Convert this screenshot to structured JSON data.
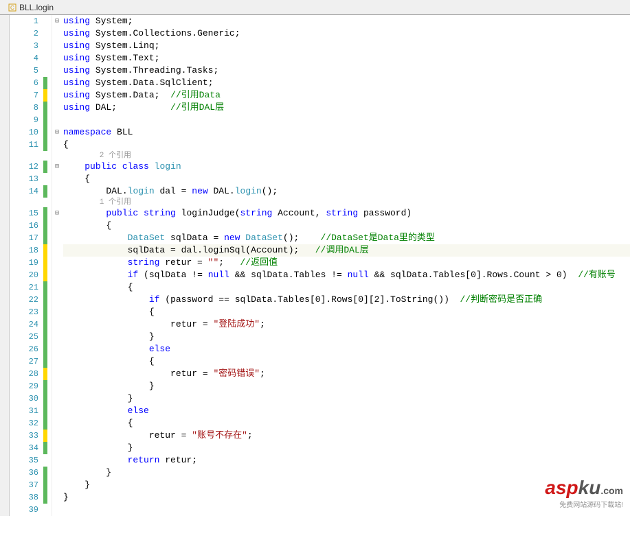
{
  "tab": {
    "title": "BLL.login"
  },
  "refs": {
    "ref2": "2 个引用",
    "ref1": "1 个引用"
  },
  "code": {
    "l1": {
      "p": [
        [
          "kw",
          "using"
        ],
        [
          "id",
          " System"
        ],
        [
          "pun",
          ";"
        ]
      ]
    },
    "l2": {
      "p": [
        [
          "kw",
          "using"
        ],
        [
          "id",
          " System"
        ],
        [
          "pun",
          "."
        ],
        [
          "id",
          "Collections"
        ],
        [
          "pun",
          "."
        ],
        [
          "id",
          "Generic"
        ],
        [
          "pun",
          ";"
        ]
      ]
    },
    "l3": {
      "p": [
        [
          "kw",
          "using"
        ],
        [
          "id",
          " System"
        ],
        [
          "pun",
          "."
        ],
        [
          "id",
          "Linq"
        ],
        [
          "pun",
          ";"
        ]
      ]
    },
    "l4": {
      "p": [
        [
          "kw",
          "using"
        ],
        [
          "id",
          " System"
        ],
        [
          "pun",
          "."
        ],
        [
          "id",
          "Text"
        ],
        [
          "pun",
          ";"
        ]
      ]
    },
    "l5": {
      "p": [
        [
          "kw",
          "using"
        ],
        [
          "id",
          " System"
        ],
        [
          "pun",
          "."
        ],
        [
          "id",
          "Threading"
        ],
        [
          "pun",
          "."
        ],
        [
          "id",
          "Tasks"
        ],
        [
          "pun",
          ";"
        ]
      ]
    },
    "l6": {
      "p": [
        [
          "kw",
          "using"
        ],
        [
          "id",
          " System"
        ],
        [
          "pun",
          "."
        ],
        [
          "id",
          "Data"
        ],
        [
          "pun",
          "."
        ],
        [
          "id",
          "SqlClient"
        ],
        [
          "pun",
          ";"
        ]
      ]
    },
    "l7": {
      "p": [
        [
          "kw",
          "using"
        ],
        [
          "id",
          " System"
        ],
        [
          "pun",
          "."
        ],
        [
          "id",
          "Data"
        ],
        [
          "pun",
          ";  "
        ],
        [
          "cm",
          "//引用Data"
        ]
      ]
    },
    "l8": {
      "p": [
        [
          "kw",
          "using"
        ],
        [
          "id",
          " DAL"
        ],
        [
          "pun",
          ";          "
        ],
        [
          "cm",
          "//引用DAL层"
        ]
      ]
    },
    "l9": {
      "p": []
    },
    "l10": {
      "p": [
        [
          "kw",
          "namespace"
        ],
        [
          "id",
          " BLL"
        ]
      ]
    },
    "l11": {
      "p": [
        [
          "pun",
          "{"
        ]
      ]
    },
    "l12": {
      "p": [
        [
          "id",
          "    "
        ],
        [
          "kw",
          "public"
        ],
        [
          "id",
          " "
        ],
        [
          "kw",
          "class"
        ],
        [
          "id",
          " "
        ],
        [
          "type",
          "login"
        ]
      ]
    },
    "l13": {
      "p": [
        [
          "pun",
          "    {"
        ]
      ]
    },
    "l14": {
      "p": [
        [
          "id",
          "        DAL"
        ],
        [
          "pun",
          "."
        ],
        [
          "type",
          "login"
        ],
        [
          "id",
          " dal "
        ],
        [
          "pun",
          "="
        ],
        [
          "id",
          " "
        ],
        [
          "kw",
          "new"
        ],
        [
          "id",
          " DAL"
        ],
        [
          "pun",
          "."
        ],
        [
          "type",
          "login"
        ],
        [
          "pun",
          "();"
        ]
      ]
    },
    "l15": {
      "p": [
        [
          "id",
          "        "
        ],
        [
          "kw",
          "public"
        ],
        [
          "id",
          " "
        ],
        [
          "kw",
          "string"
        ],
        [
          "id",
          " loginJudge"
        ],
        [
          "pun",
          "("
        ],
        [
          "kw",
          "string"
        ],
        [
          "id",
          " Account"
        ],
        [
          "pun",
          ", "
        ],
        [
          "kw",
          "string"
        ],
        [
          "id",
          " password"
        ],
        [
          "pun",
          ")"
        ]
      ]
    },
    "l16": {
      "p": [
        [
          "pun",
          "        {"
        ]
      ]
    },
    "l17": {
      "p": [
        [
          "id",
          "            "
        ],
        [
          "type",
          "DataSet"
        ],
        [
          "id",
          " sqlData "
        ],
        [
          "pun",
          "="
        ],
        [
          "id",
          " "
        ],
        [
          "kw",
          "new"
        ],
        [
          "id",
          " "
        ],
        [
          "type",
          "DataSet"
        ],
        [
          "pun",
          "();    "
        ],
        [
          "cm",
          "//DataSet是Data里的类型"
        ]
      ]
    },
    "l18": {
      "p": [
        [
          "id",
          "            sqlData "
        ],
        [
          "pun",
          "="
        ],
        [
          "id",
          " dal"
        ],
        [
          "pun",
          "."
        ],
        [
          "id",
          "loginSql"
        ],
        [
          "pun",
          "("
        ],
        [
          "id",
          "Account"
        ],
        [
          "pun",
          ");   "
        ],
        [
          "cm",
          "//调用DAL层"
        ]
      ]
    },
    "l19": {
      "p": [
        [
          "id",
          "            "
        ],
        [
          "kw",
          "string"
        ],
        [
          "id",
          " retur "
        ],
        [
          "pun",
          "="
        ],
        [
          "id",
          " "
        ],
        [
          "str",
          "\"\""
        ],
        [
          "pun",
          ";   "
        ],
        [
          "cm",
          "//返回值"
        ]
      ]
    },
    "l20": {
      "p": [
        [
          "id",
          "            "
        ],
        [
          "kw",
          "if"
        ],
        [
          "id",
          " "
        ],
        [
          "pun",
          "("
        ],
        [
          "id",
          "sqlData "
        ],
        [
          "pun",
          "!="
        ],
        [
          "id",
          " "
        ],
        [
          "kw",
          "null"
        ],
        [
          "id",
          " "
        ],
        [
          "pun",
          "&&"
        ],
        [
          "id",
          " sqlData"
        ],
        [
          "pun",
          "."
        ],
        [
          "id",
          "Tables "
        ],
        [
          "pun",
          "!="
        ],
        [
          "id",
          " "
        ],
        [
          "kw",
          "null"
        ],
        [
          "id",
          " "
        ],
        [
          "pun",
          "&&"
        ],
        [
          "id",
          " sqlData"
        ],
        [
          "pun",
          "."
        ],
        [
          "id",
          "Tables"
        ],
        [
          "pun",
          "["
        ],
        [
          "id",
          "0"
        ],
        [
          "pun",
          "]."
        ],
        [
          "id",
          "Rows"
        ],
        [
          "pun",
          "."
        ],
        [
          "id",
          "Count "
        ],
        [
          "pun",
          ">"
        ],
        [
          "id",
          " 0"
        ],
        [
          "pun",
          ")  "
        ],
        [
          "cm",
          "//有账号"
        ]
      ]
    },
    "l21": {
      "p": [
        [
          "pun",
          "            {"
        ]
      ]
    },
    "l22": {
      "p": [
        [
          "id",
          "                "
        ],
        [
          "kw",
          "if"
        ],
        [
          "id",
          " "
        ],
        [
          "pun",
          "("
        ],
        [
          "id",
          "password "
        ],
        [
          "pun",
          "=="
        ],
        [
          "id",
          " sqlData"
        ],
        [
          "pun",
          "."
        ],
        [
          "id",
          "Tables"
        ],
        [
          "pun",
          "["
        ],
        [
          "id",
          "0"
        ],
        [
          "pun",
          "]."
        ],
        [
          "id",
          "Rows"
        ],
        [
          "pun",
          "["
        ],
        [
          "id",
          "0"
        ],
        [
          "pun",
          "]["
        ],
        [
          "id",
          "2"
        ],
        [
          "pun",
          "]."
        ],
        [
          "id",
          "ToString"
        ],
        [
          "pun",
          "())  "
        ],
        [
          "cm",
          "//判断密码是否正确"
        ]
      ]
    },
    "l23": {
      "p": [
        [
          "pun",
          "                {"
        ]
      ]
    },
    "l24": {
      "p": [
        [
          "id",
          "                    retur "
        ],
        [
          "pun",
          "="
        ],
        [
          "id",
          " "
        ],
        [
          "str",
          "\"登陆成功\""
        ],
        [
          "pun",
          ";"
        ]
      ]
    },
    "l25": {
      "p": [
        [
          "pun",
          "                }"
        ]
      ]
    },
    "l26": {
      "p": [
        [
          "id",
          "                "
        ],
        [
          "kw",
          "else"
        ]
      ]
    },
    "l27": {
      "p": [
        [
          "pun",
          "                {"
        ]
      ]
    },
    "l28": {
      "p": [
        [
          "id",
          "                    retur "
        ],
        [
          "pun",
          "="
        ],
        [
          "id",
          " "
        ],
        [
          "str",
          "\"密码错误\""
        ],
        [
          "pun",
          ";"
        ]
      ]
    },
    "l29": {
      "p": [
        [
          "pun",
          "                }"
        ]
      ]
    },
    "l30": {
      "p": [
        [
          "pun",
          "            }"
        ]
      ]
    },
    "l31": {
      "p": [
        [
          "id",
          "            "
        ],
        [
          "kw",
          "else"
        ]
      ]
    },
    "l32": {
      "p": [
        [
          "pun",
          "            {"
        ]
      ]
    },
    "l33": {
      "p": [
        [
          "id",
          "                retur "
        ],
        [
          "pun",
          "="
        ],
        [
          "id",
          " "
        ],
        [
          "str",
          "\"账号不存在\""
        ],
        [
          "pun",
          ";"
        ]
      ]
    },
    "l34": {
      "p": [
        [
          "pun",
          "            }"
        ]
      ]
    },
    "l35": {
      "p": [
        [
          "id",
          "            "
        ],
        [
          "kw",
          "return"
        ],
        [
          "id",
          " retur"
        ],
        [
          "pun",
          ";"
        ]
      ]
    },
    "l36": {
      "p": [
        [
          "pun",
          "        }"
        ]
      ]
    },
    "l37": {
      "p": [
        [
          "pun",
          "    }"
        ]
      ]
    },
    "l38": {
      "p": [
        [
          "pun",
          "}"
        ]
      ]
    }
  },
  "lines": [
    {
      "num": 1,
      "mark": "",
      "fold": "minus",
      "key": "l1"
    },
    {
      "num": 2,
      "mark": "",
      "fold": "",
      "key": "l2"
    },
    {
      "num": 3,
      "mark": "",
      "fold": "",
      "key": "l3"
    },
    {
      "num": 4,
      "mark": "",
      "fold": "",
      "key": "l4"
    },
    {
      "num": 5,
      "mark": "",
      "fold": "",
      "key": "l5"
    },
    {
      "num": 6,
      "mark": "green",
      "fold": "",
      "key": "l6"
    },
    {
      "num": 7,
      "mark": "yellow",
      "fold": "",
      "key": "l7"
    },
    {
      "num": 8,
      "mark": "green",
      "fold": "",
      "key": "l8"
    },
    {
      "num": 9,
      "mark": "green",
      "fold": "",
      "key": "l9"
    },
    {
      "num": 10,
      "mark": "green",
      "fold": "minus",
      "key": "l10"
    },
    {
      "num": 11,
      "mark": "green",
      "fold": "",
      "key": "l11"
    },
    {
      "ref": "ref2",
      "indent": "        "
    },
    {
      "num": 12,
      "mark": "green",
      "fold": "minus",
      "key": "l12"
    },
    {
      "num": 13,
      "mark": "",
      "fold": "",
      "key": "l13"
    },
    {
      "num": 14,
      "mark": "green",
      "fold": "",
      "key": "l14"
    },
    {
      "ref": "ref1",
      "indent": "        "
    },
    {
      "num": 15,
      "mark": "green",
      "fold": "minus",
      "key": "l15"
    },
    {
      "num": 16,
      "mark": "green",
      "fold": "",
      "key": "l16"
    },
    {
      "num": 17,
      "mark": "green",
      "fold": "",
      "key": "l17"
    },
    {
      "num": 18,
      "mark": "yellow",
      "fold": "",
      "key": "l18",
      "highlighted": true
    },
    {
      "num": 19,
      "mark": "yellow",
      "fold": "",
      "key": "l19"
    },
    {
      "num": 20,
      "mark": "yellow",
      "fold": "",
      "key": "l20"
    },
    {
      "num": 21,
      "mark": "green",
      "fold": "",
      "key": "l21"
    },
    {
      "num": 22,
      "mark": "green",
      "fold": "",
      "key": "l22"
    },
    {
      "num": 23,
      "mark": "green",
      "fold": "",
      "key": "l23"
    },
    {
      "num": 24,
      "mark": "green",
      "fold": "",
      "key": "l24"
    },
    {
      "num": 25,
      "mark": "green",
      "fold": "",
      "key": "l25"
    },
    {
      "num": 26,
      "mark": "green",
      "fold": "",
      "key": "l26"
    },
    {
      "num": 27,
      "mark": "green",
      "fold": "",
      "key": "l27"
    },
    {
      "num": 28,
      "mark": "yellow",
      "fold": "",
      "key": "l28"
    },
    {
      "num": 29,
      "mark": "green",
      "fold": "",
      "key": "l29"
    },
    {
      "num": 30,
      "mark": "green",
      "fold": "",
      "key": "l30"
    },
    {
      "num": 31,
      "mark": "green",
      "fold": "",
      "key": "l31"
    },
    {
      "num": 32,
      "mark": "green",
      "fold": "",
      "key": "l32"
    },
    {
      "num": 33,
      "mark": "yellow",
      "fold": "",
      "key": "l33"
    },
    {
      "num": 34,
      "mark": "green",
      "fold": "",
      "key": "l34"
    },
    {
      "num": 35,
      "mark": "",
      "fold": "",
      "key": "l35"
    },
    {
      "num": 36,
      "mark": "green",
      "fold": "",
      "key": "l36"
    },
    {
      "num": 37,
      "mark": "green",
      "fold": "",
      "key": "l37"
    },
    {
      "num": 38,
      "mark": "green",
      "fold": "",
      "key": "l38"
    },
    {
      "num": 39,
      "mark": "",
      "fold": "",
      "key": ""
    }
  ],
  "watermark": {
    "main1": "asp",
    "main2": "ku",
    "suffix": ".com",
    "sub": "免费网站源码下载站!"
  }
}
